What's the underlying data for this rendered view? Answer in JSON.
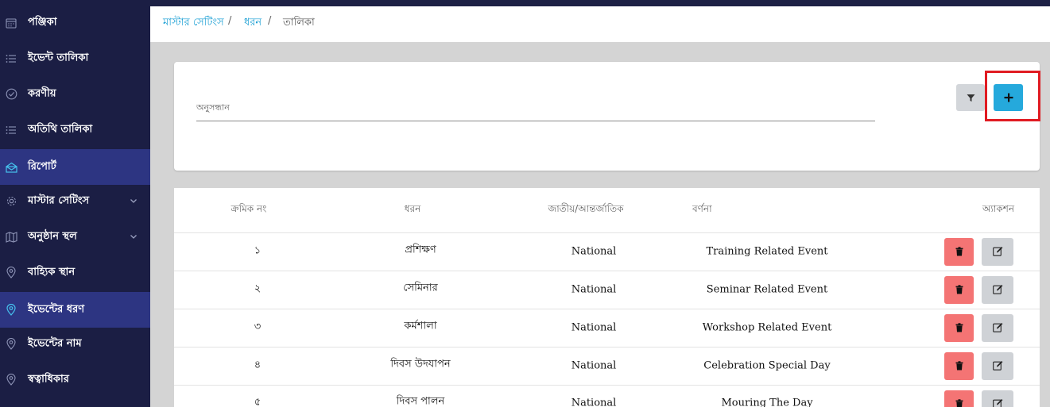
{
  "sidebar": {
    "items": [
      {
        "label": "পঞ্জিকা",
        "icon": "calendar-icon",
        "active": false
      },
      {
        "label": "ইভেন্ট তালিকা",
        "icon": "list-icon",
        "active": false
      },
      {
        "label": "করণীয়",
        "icon": "check-circle-icon",
        "active": false
      },
      {
        "label": "অতিথি তালিকা",
        "icon": "list-icon",
        "active": false
      },
      {
        "label": "রিপোর্ট",
        "icon": "mail-open-icon",
        "active": true
      },
      {
        "label": "মাস্টার সেটিংস",
        "icon": "gear-icon",
        "active": false,
        "expandable": true
      },
      {
        "label": "অনুষ্ঠান স্থল",
        "icon": "map-icon",
        "active": false,
        "expandable": true
      },
      {
        "label": "বাহ্যিক স্থান",
        "icon": "location-pin-icon",
        "active": false
      },
      {
        "label": "ইভেন্টের ধরণ",
        "icon": "location-pin-icon",
        "active": true
      },
      {
        "label": "ইভেন্টের নাম",
        "icon": "location-pin-icon",
        "active": false
      },
      {
        "label": "স্বত্বাধিকার",
        "icon": "location-pin-icon",
        "active": false
      }
    ]
  },
  "breadcrumb": {
    "items": [
      "মাস্টার সেটিংস",
      "ধরন",
      "তালিকা"
    ],
    "separator": "/"
  },
  "search": {
    "label": "অনুসন্ধান",
    "value": "",
    "filter_icon": "filter-icon",
    "add_icon": "plus-icon"
  },
  "table": {
    "headers": {
      "serial": "ক্রমিক নং",
      "type": "ধরন",
      "scope": "জাতীয়/আন্তর্জাতিক",
      "description": "বর্ণনা",
      "action": "অ্যাকশন"
    },
    "rows": [
      {
        "serial": "১",
        "type": "প্রশিক্ষণ",
        "scope": "National",
        "description": "Training Related Event"
      },
      {
        "serial": "২",
        "type": "সেমিনার",
        "scope": "National",
        "description": "Seminar Related Event"
      },
      {
        "serial": "৩",
        "type": "কর্মশালা",
        "scope": "National",
        "description": "Workshop Related Event"
      },
      {
        "serial": "৪",
        "type": "দিবস উদযাপন",
        "scope": "National",
        "description": "Celebration Special Day"
      },
      {
        "serial": "৫",
        "type": "দিবস পালন",
        "scope": "National",
        "description": "Mouring The Day"
      }
    ]
  },
  "colors": {
    "sidebar_bg": "#1b1e44",
    "sidebar_active": "#2d3582",
    "accent": "#25a9dc",
    "delete": "#f47474",
    "highlight": "#e01b22"
  }
}
